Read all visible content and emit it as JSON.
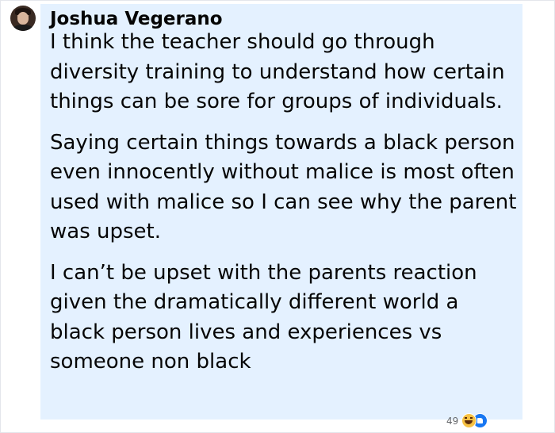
{
  "comment": {
    "author": "Joshua Vegerano",
    "paragraphs": [
      "I think the teacher should go through diversity training to understand how certain things can be sore for groups of individuals.",
      "Saying certain things towards a black person even innocently without malice is most often used with malice so I can see why the parent was upset.",
      "I can’t be upset with the parents reaction given the dramatically different world a black person lives and experiences vs someone non black"
    ],
    "reaction_count": "49",
    "reactions": [
      "haha-icon",
      "like-icon"
    ]
  },
  "colors": {
    "bubble": "#e4f1ff",
    "text": "#050505",
    "count": "#65676b",
    "like": "#1877f2",
    "haha": "#f7c244"
  }
}
